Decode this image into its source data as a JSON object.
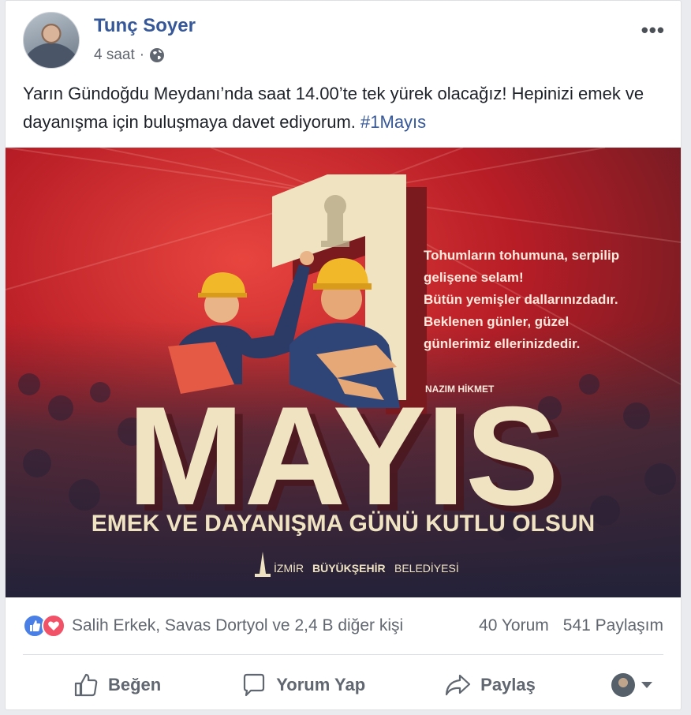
{
  "post": {
    "author": "Tunç Soyer",
    "time": "4 saat",
    "separator": "·",
    "text_main": "Yarın Gündoğdu Meydanı’nda saat 14.00’te tek yürek olacağız! Hepinizi emek ve dayanışma için buluşmaya davet ediyorum.",
    "hashtag": "#1Mayıs",
    "more": "•••"
  },
  "image": {
    "quote_lines": [
      "Tohumların tohumuna, serpilip",
      "gelişene selam!",
      "Bütün yemişler dallarınızdadır.",
      "Beklenen günler, güzel",
      "günlerimiz ellerinizdedir."
    ],
    "quote_author": "NAZIM HİKMET",
    "big_number": "1",
    "big_word": "MAYIS",
    "slogan": "EMEK VE DAYANIŞMA GÜNÜ KUTLU OLSUN",
    "logo_text_thin": "İZMİR",
    "logo_text_bold": "BÜYÜKŞEHİR",
    "logo_text_end": "BELEDİYESİ"
  },
  "stats": {
    "reactors": "Salih Erkek, Savas Dortyol ve 2,4 B diğer kişi",
    "comments": "40 Yorum",
    "shares": "541 Paylaşım"
  },
  "actions": {
    "like": "Beğen",
    "comment": "Yorum Yap",
    "share": "Paylaş"
  },
  "colors": {
    "brand_blue": "#365899",
    "like_blue": "#4a7fe6",
    "love_red": "#f25268",
    "poster_red": "#c8202a",
    "poster_cream": "#f2e6c4"
  }
}
